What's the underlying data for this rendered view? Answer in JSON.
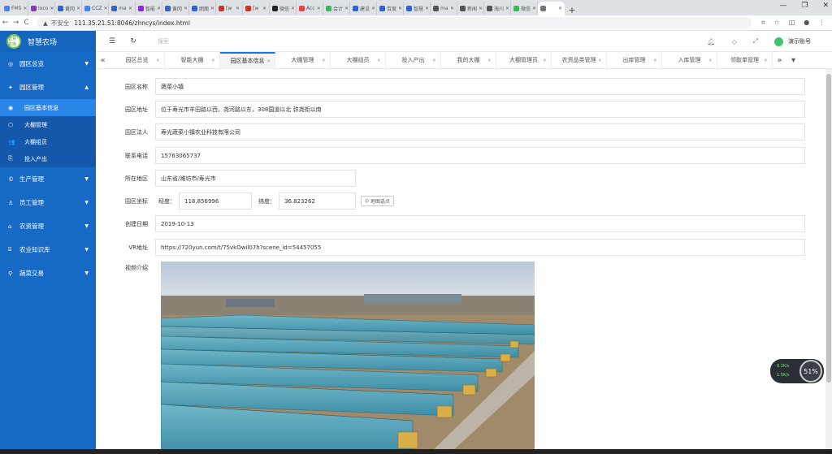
{
  "browser": {
    "tabs": [
      {
        "label": "FMS",
        "color": "#4285f4"
      },
      {
        "label": "loco",
        "color": "#7b3fb8"
      },
      {
        "label": "黄冈",
        "color": "#2f62d8"
      },
      {
        "label": "CCZ",
        "color": "#4285f4"
      },
      {
        "label": "ma",
        "color": "#2f62d8"
      },
      {
        "label": "智能",
        "color": "#8a2be2"
      },
      {
        "label": "黄冈",
        "color": "#2f62d8"
      },
      {
        "label": "图面",
        "color": "#2f62d8"
      },
      {
        "label": "[w",
        "color": "#d93025"
      },
      {
        "label": "[w",
        "color": "#d93025"
      },
      {
        "label": "微信",
        "color": "#222"
      },
      {
        "label": "Acc",
        "color": "#e8453c"
      },
      {
        "label": "会计",
        "color": "#2fbf4f"
      },
      {
        "label": "建设",
        "color": "#2f62d8"
      },
      {
        "label": "百度",
        "color": "#2f62d8"
      },
      {
        "label": "智慧",
        "color": "#2f62d8"
      },
      {
        "label": "ma",
        "color": "#555"
      },
      {
        "label": "新闻",
        "color": "#555"
      },
      {
        "label": "海川",
        "color": "#555"
      },
      {
        "label": "微信",
        "color": "#2fbf4f"
      },
      {
        "label": "",
        "color": "#777"
      }
    ],
    "new_tab": "+",
    "url": "111.35.21.51:8046/zhncys/index.html",
    "security": "不安全"
  },
  "sidebar": {
    "logo_text": "智慧农场",
    "title": "智慧农场",
    "menu": [
      {
        "label": "园区总览",
        "icon": "◎",
        "arrow": "▼",
        "expanded": false
      },
      {
        "label": "园区管理",
        "icon": "✦",
        "arrow": "▲",
        "expanded": true
      }
    ],
    "submenu": [
      {
        "label": "园区基本信息",
        "icon": "◉",
        "active": true
      },
      {
        "label": "大棚管理",
        "icon": "⬡",
        "active": false
      },
      {
        "label": "大棚组员",
        "icon": "👥",
        "active": false
      },
      {
        "label": "投入产出",
        "icon": "⎘",
        "active": false
      }
    ],
    "menu2": [
      {
        "label": "生产管理",
        "icon": "©",
        "arrow": "▼"
      },
      {
        "label": "员工管理",
        "icon": "♙",
        "arrow": "▼"
      },
      {
        "label": "农资管理",
        "icon": "⌂",
        "arrow": "▼"
      },
      {
        "label": "农业知识库",
        "icon": "⌸",
        "arrow": "▼"
      },
      {
        "label": "蔬菜交易",
        "icon": "⚲",
        "arrow": "▼"
      }
    ]
  },
  "topbar": {
    "search_placeholder": "搜索",
    "username": "演示账号"
  },
  "page_tabs": [
    {
      "label": "园区总览",
      "active": false
    },
    {
      "label": "智能大棚",
      "active": false
    },
    {
      "label": "园区基本信息",
      "active": true
    },
    {
      "label": "大棚管理",
      "active": false
    },
    {
      "label": "大棚组员",
      "active": false
    },
    {
      "label": "投入产出",
      "active": false
    },
    {
      "label": "我的大棚",
      "active": false
    },
    {
      "label": "大棚管理员",
      "active": false
    },
    {
      "label": "农资品类管理",
      "active": false
    },
    {
      "label": "出库管理",
      "active": false
    },
    {
      "label": "入库管理",
      "active": false
    },
    {
      "label": "领取单管理",
      "active": false
    }
  ],
  "form": {
    "name_label": "园区名称",
    "name_value": "蔬菜小镇",
    "address_label": "园区地址",
    "address_value": "位于寿光市羊田路以西，尧河路以东，308国道以北 弥尧街以南",
    "legal_label": "园区法人",
    "legal_value": "寿光蔬菜小镇农业科技有限公司",
    "phone_label": "联系电话",
    "phone_value": "15763065737",
    "region_label": "所在地区",
    "region_value": "山东省/潍坊市/寿光市",
    "coord_label": "园区坐标",
    "lng_label": "经度：",
    "lng_value": "118.856996",
    "lat_label": "纬度：",
    "lat_value": "36.823262",
    "map_button": "地图选点",
    "date_label": "创建日期",
    "date_value": "2019-10-13",
    "vr_label": "VR地址",
    "vr_value": "https://720yun.com/t/75vkOwil07h?scene_id=54457055",
    "video_label": "视频介绍"
  },
  "speed_widget": {
    "up": "0.2K/s",
    "down": "1.5K/s",
    "percent": "51%"
  }
}
